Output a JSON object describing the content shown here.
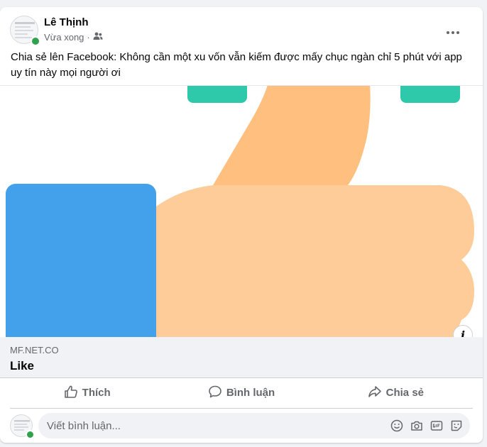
{
  "post": {
    "author": "Lê Thịnh",
    "time": "Vừa xong",
    "separator": "·",
    "privacy_icon": "friends-icon",
    "text": "Chia sẻ lên Facebook: Không cần một xu vốn vẫn kiếm được mấy chục ngàn chỉ 5 phút với app uy tín này mọi người ơi"
  },
  "link": {
    "domain": "MF.NET.CO",
    "title": "Like",
    "info_icon": "info-icon",
    "info_glyph": "i"
  },
  "actions": {
    "like": "Thích",
    "comment": "Bình luận",
    "share": "Chia sẻ"
  },
  "comment": {
    "placeholder": "Viết bình luận..."
  },
  "colors": {
    "online": "#31a24c",
    "thumb": "#fdcc99",
    "thumb_dark": "#ffc07f",
    "cuff": "#42a1ea",
    "accent": "#2ec8aa"
  }
}
